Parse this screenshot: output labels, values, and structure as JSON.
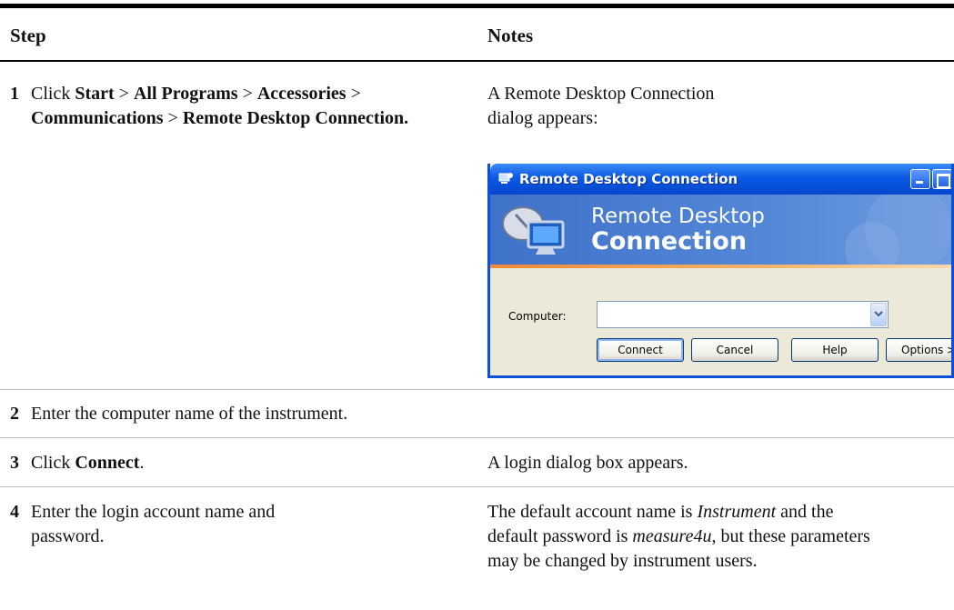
{
  "table": {
    "header_step": "Step",
    "header_notes": "Notes"
  },
  "rows": [
    {
      "number": "1",
      "step": {
        "click": "Click ",
        "start": "Start",
        "sep1": " > ",
        "all_programs": "All Programs",
        "sep2": " > ",
        "accessories": "Accessories",
        "sep3": " > ",
        "communications": "Communications",
        "sep4": " > ",
        "rdc": "Remote Desktop Connection."
      },
      "note": "A Remote Desktop Connection dialog appears:"
    },
    {
      "number": "2",
      "step": "Enter the computer name of the instrument.",
      "note": ""
    },
    {
      "number": "3",
      "step": {
        "prefix": "Click ",
        "bold": "Connect",
        "suffix": "."
      },
      "note": "A login dialog box appears."
    },
    {
      "number": "4",
      "step": "Enter the login account name and password.",
      "note": {
        "p1": "The default account name is ",
        "account": "Instrument",
        "p2": " and the default password is ",
        "password": "measure4u",
        "p3": ", but these parameters may be changed by instrument users."
      }
    }
  ],
  "dialog": {
    "title": "Remote Desktop Connection",
    "banner_line1": "Remote Desktop",
    "banner_line2": "Connection",
    "computer_label": "Computer:",
    "computer_value": "",
    "buttons": {
      "connect": "Connect",
      "cancel": "Cancel",
      "help": "Help",
      "options": "Options >"
    },
    "icons": {
      "title": "remote-desktop-icon",
      "banner": "computer-satellite-icon",
      "dropdown": "chevron-down-icon"
    },
    "colors": {
      "titlebar": "#0a5ae6",
      "banner": "#4a7fd2",
      "accent_line": "#f0883a",
      "face": "#ece9d8"
    }
  }
}
